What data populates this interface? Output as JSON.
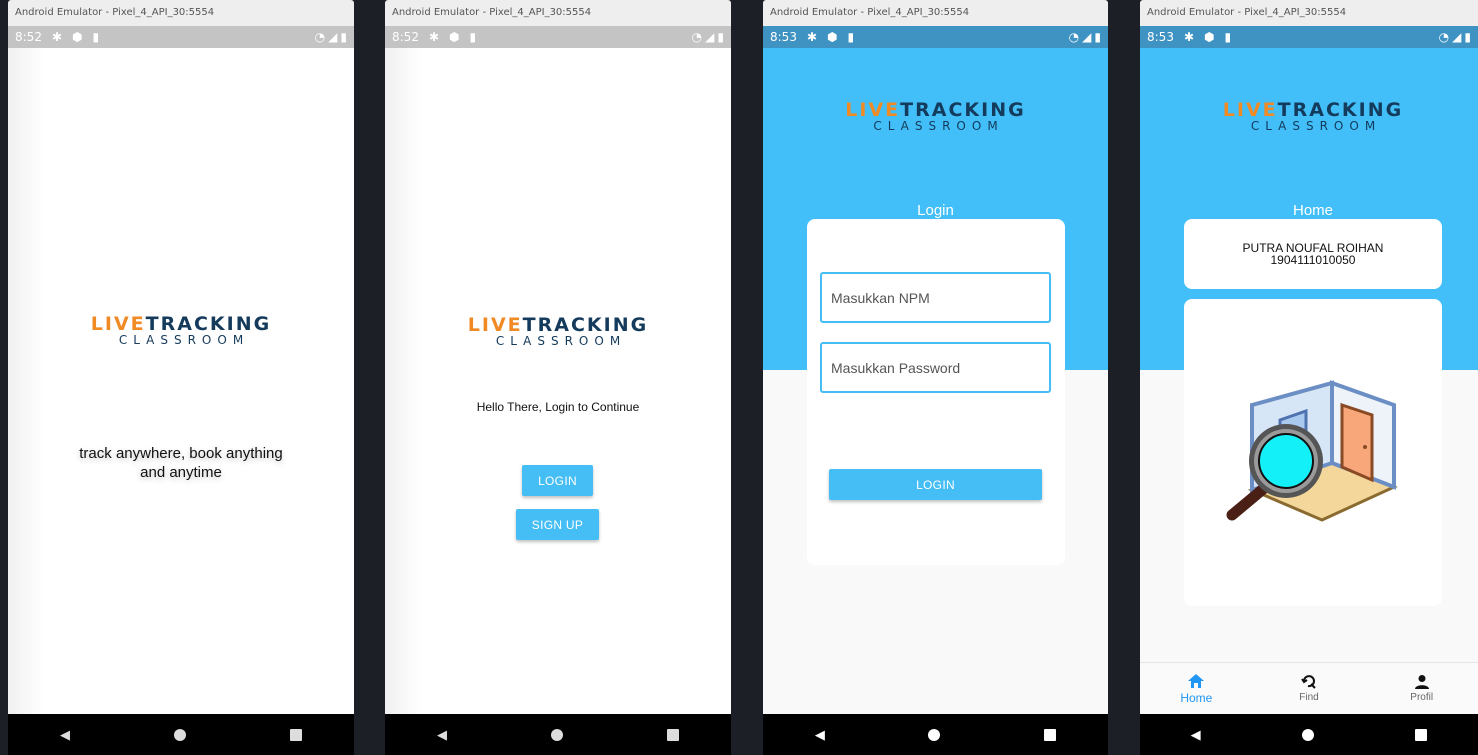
{
  "window_title": "Android Emulator - Pixel_4_API_30:5554",
  "screens": [
    {
      "time": "8:52"
    },
    {
      "time": "8:52"
    },
    {
      "time": "8:53"
    },
    {
      "time": "8:53"
    }
  ],
  "logo": {
    "line1_part1": "LIVE",
    "line1_part2": "TRACKING",
    "line2": "CLASSROOM"
  },
  "splash": {
    "tagline_line1": "track anywhere, book anything",
    "tagline_line2": "and anytime"
  },
  "welcome": {
    "message": "Hello There, Login to Continue",
    "login_label": "LOGIN",
    "signup_label": "SIGN UP"
  },
  "login": {
    "title": "Login",
    "npm_placeholder": "Masukkan NPM",
    "password_placeholder": "Masukkan Password",
    "login_label": "LOGIN"
  },
  "home": {
    "title": "Home",
    "user_name": "PUTRA NOUFAL ROIHAN",
    "user_npm": "1904111010050",
    "nav": [
      {
        "label": "Home",
        "icon": "home-icon"
      },
      {
        "label": "Find",
        "icon": "find-icon"
      },
      {
        "label": "Profil",
        "icon": "person-icon"
      }
    ]
  },
  "colors": {
    "accent": "#45bdf5",
    "header_blue": "#42bff8",
    "logo_orange": "#f08a24",
    "logo_navy": "#143a5c",
    "nav_active": "#2196f3"
  }
}
